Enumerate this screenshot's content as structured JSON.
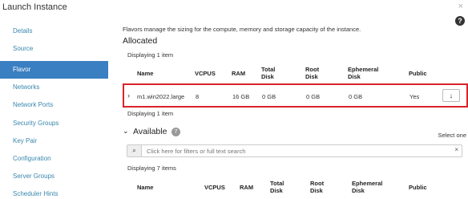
{
  "window": {
    "title": "Launch Instance",
    "close_glyph": "×",
    "help_glyph": "?"
  },
  "sidebar": {
    "items": [
      {
        "label": "Details"
      },
      {
        "label": "Source"
      },
      {
        "label": "Flavor"
      },
      {
        "label": "Networks"
      },
      {
        "label": "Network Ports"
      },
      {
        "label": "Security Groups"
      },
      {
        "label": "Key Pair"
      },
      {
        "label": "Configuration"
      },
      {
        "label": "Server Groups"
      },
      {
        "label": "Scheduler Hints"
      }
    ],
    "active": "Flavor"
  },
  "main": {
    "description": "Flavors manage the sizing for the compute, memory and storage capacity of the instance.",
    "allocated": {
      "title": "Allocated",
      "displaying_top": "Displaying 1 item",
      "displaying_bottom": "Displaying 1 item",
      "columns": {
        "name": "Name",
        "vcpus": "VCPUS",
        "ram": "RAM",
        "total_disk_1": "Total",
        "total_disk_2": "Disk",
        "root_disk_1": "Root",
        "root_disk_2": "Disk",
        "ephemeral_1": "Ephemeral",
        "ephemeral_2": "Disk",
        "public": "Public"
      },
      "row": {
        "expand_glyph": "›",
        "name": "m1.win2022.large",
        "vcpus": "8",
        "ram": "16 GB",
        "total_disk": "0 GB",
        "root_disk": "0 GB",
        "ephemeral_disk": "0 GB",
        "public": "Yes",
        "action_glyph": "↓"
      }
    },
    "available": {
      "title": "Available",
      "count": "7",
      "chevron_glyph": "⌄",
      "select_one": "Select one",
      "search_placeholder": "Click here for filters or full text search",
      "search_glyph": "⌕",
      "clear_glyph": "×",
      "displaying": "Displaying 7 items",
      "columns": {
        "name": "Name",
        "vcpus": "VCPUS",
        "ram": "RAM",
        "total_disk_1": "Total",
        "total_disk_2": "Disk",
        "root_disk_1": "Root",
        "root_disk_2": "Disk",
        "ephemeral_1": "Ephemeral",
        "ephemeral_2": "Disk",
        "public": "Public"
      }
    }
  },
  "colors": {
    "accent": "#3a7fc1",
    "link": "#3a87ad",
    "highlight_border": "#d9232a"
  }
}
